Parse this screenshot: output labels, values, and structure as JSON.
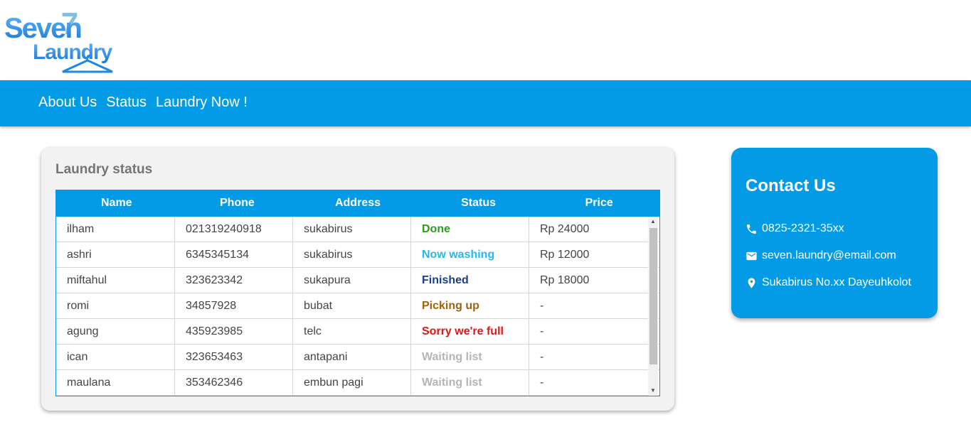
{
  "logo": {
    "line1": "Seven",
    "line2": "Laundry",
    "mark": "7"
  },
  "nav": {
    "items": [
      "About Us",
      "Status",
      "Laundry Now !"
    ]
  },
  "status_card": {
    "title": "Laundry status",
    "columns": [
      "Name",
      "Phone",
      "Address",
      "Status",
      "Price"
    ],
    "rows": [
      {
        "name": "ilham",
        "phone": "021319240918",
        "address": "sukabirus",
        "status": "Done",
        "status_color": "#2a9d1f",
        "price": "Rp 24000"
      },
      {
        "name": "ashri",
        "phone": "6345345134",
        "address": "sukabirus",
        "status": "Now washing",
        "status_color": "#29b6e8",
        "price": "Rp 12000"
      },
      {
        "name": "miftahul",
        "phone": "323623342",
        "address": "sukapura",
        "status": "Finished",
        "status_color": "#1a3f86",
        "price": "Rp 18000"
      },
      {
        "name": "romi",
        "phone": "34857928",
        "address": "bubat",
        "status": "Picking up",
        "status_color": "#a0620c",
        "price": "-"
      },
      {
        "name": "agung",
        "phone": "435923985",
        "address": "telc",
        "status": "Sorry we're full",
        "status_color": "#e01515",
        "price": "-"
      },
      {
        "name": "ican",
        "phone": "323653463",
        "address": "antapani",
        "status": "Waiting list",
        "status_color": "#b5b5b5",
        "price": "-"
      },
      {
        "name": "maulana",
        "phone": "353462346",
        "address": "embun pagi",
        "status": "Waiting list",
        "status_color": "#b5b5b5",
        "price": "-"
      }
    ]
  },
  "contact": {
    "title": "Contact Us",
    "phone": {
      "icon": "phone-icon",
      "text": "0825-2321-35xx"
    },
    "email": {
      "icon": "mail-icon",
      "text": "seven.laundry@email.com"
    },
    "address": {
      "icon": "location-pin-icon",
      "text": "Sukabirus No.xx Dayeuhkolot"
    }
  },
  "colors": {
    "primary": "#039be5",
    "card_bg": "#f2f2f2"
  }
}
